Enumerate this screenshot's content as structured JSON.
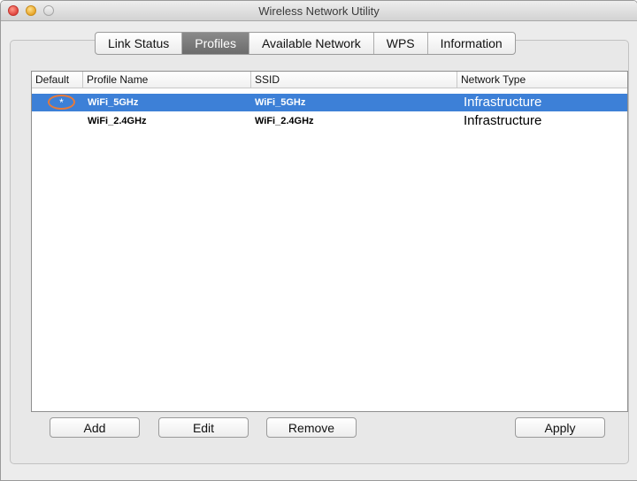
{
  "window": {
    "title": "Wireless Network Utility"
  },
  "tabs": [
    {
      "label": "Link Status"
    },
    {
      "label": "Profiles",
      "active": true
    },
    {
      "label": "Available Network"
    },
    {
      "label": "WPS"
    },
    {
      "label": "Information"
    }
  ],
  "table": {
    "columns": [
      "Default",
      "Profile Name",
      "SSID",
      "Network Type"
    ],
    "rows": [
      {
        "default": "*",
        "profile_name": "WiFi_5GHz",
        "ssid": "WiFi_5GHz",
        "network_type": "Infrastructure",
        "selected": true
      },
      {
        "default": "",
        "profile_name": "WiFi_2.4GHz",
        "ssid": "WiFi_2.4GHz",
        "network_type": "Infrastructure",
        "selected": false
      }
    ]
  },
  "buttons": {
    "add": "Add",
    "edit": "Edit",
    "remove": "Remove",
    "apply": "Apply"
  },
  "colors": {
    "selection": "#3d80d7",
    "default_marker_circle": "#e87a3a",
    "active_tab": "#7a7a7a"
  }
}
